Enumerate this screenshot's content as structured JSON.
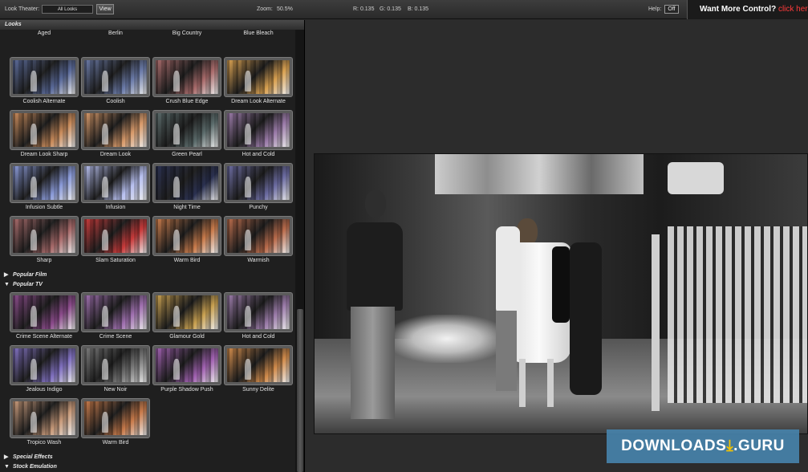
{
  "topbar": {
    "look_theater_label": "Look Theater:",
    "filter_value": "All Looks",
    "view_button": "View",
    "zoom_label": "Zoom:",
    "zoom_value": "50.5%",
    "r_readout": "R: 0.135",
    "g_readout": "G: 0.135",
    "b_readout": "B: 0.135",
    "help_label": "Help:",
    "help_toggle": "Off",
    "promo_text": "Want More Control?",
    "promo_link": "click her"
  },
  "panel": {
    "header": "Looks",
    "rows": [
      [
        "Aged",
        "Berlin",
        "Big Country",
        "Blue Bleach"
      ],
      [
        "Coolish Alternate",
        "Coolish",
        "Crush Blue Edge",
        "Dream Look Alternate"
      ],
      [
        "Dream Look Sharp",
        "Dream Look",
        "Green Pearl",
        "Hot and Cold"
      ],
      [
        "Infusion Subtle",
        "Infusion",
        "Night Time",
        "Punchy"
      ],
      [
        "Sharp",
        "Slam Saturation",
        "Warm Bird",
        "Warmish"
      ]
    ],
    "sections": {
      "popular_film": "Popular Film",
      "popular_tv": "Popular TV",
      "special_effects": "Special Effects",
      "stock_emulation": "Stock Emulation"
    },
    "tv_rows": [
      [
        "Crime Scene Alternate",
        "Crime Scene",
        "Glamour Gold",
        "Hot and Cold"
      ],
      [
        "Jealous Indigo",
        "New Noir",
        "Purple Shadow Push",
        "Sunny Delite"
      ],
      [
        "Tropico Wash",
        "Warm Bird"
      ]
    ]
  },
  "thumb_tints": {
    "Aged": "#8a6a3a",
    "Berlin": "#4a5a7a",
    "Big Country": "#9a7a4a",
    "Blue Bleach": "#7a9ac8",
    "Coolish Alternate": "#5a6a9a",
    "Coolish": "#6a7aa8",
    "Crush Blue Edge": "#a86a6a",
    "Dream Look Alternate": "#d8a050",
    "Dream Look Sharp": "#c88a5a",
    "Dream Look": "#d89a6a",
    "Green Pearl": "#5a6a6a",
    "Hot and Cold": "#9a7aa8",
    "Infusion Subtle": "#8a9ad8",
    "Infusion": "#b8c0f0",
    "Night Time": "#2a3050",
    "Punchy": "#6a6aa0",
    "Sharp": "#a86a6a",
    "Slam Saturation": "#c83a3a",
    "Warm Bird": "#c87a4a",
    "Warmish": "#b86a4a",
    "Crime Scene Alternate": "#8a4a8a",
    "Crime Scene": "#a070b0",
    "Glamour Gold": "#c8a050",
    "Jealous Indigo": "#8070c0",
    "New Noir": "#7a7a7a",
    "Purple Shadow Push": "#a060b0",
    "Sunny Delite": "#d08a4a",
    "Tropico Wash": "#c89a7a"
  },
  "watermark": {
    "text_a": "DOWNLOADS",
    "text_b": ".GURU",
    "icon": "download-arrow-icon"
  }
}
